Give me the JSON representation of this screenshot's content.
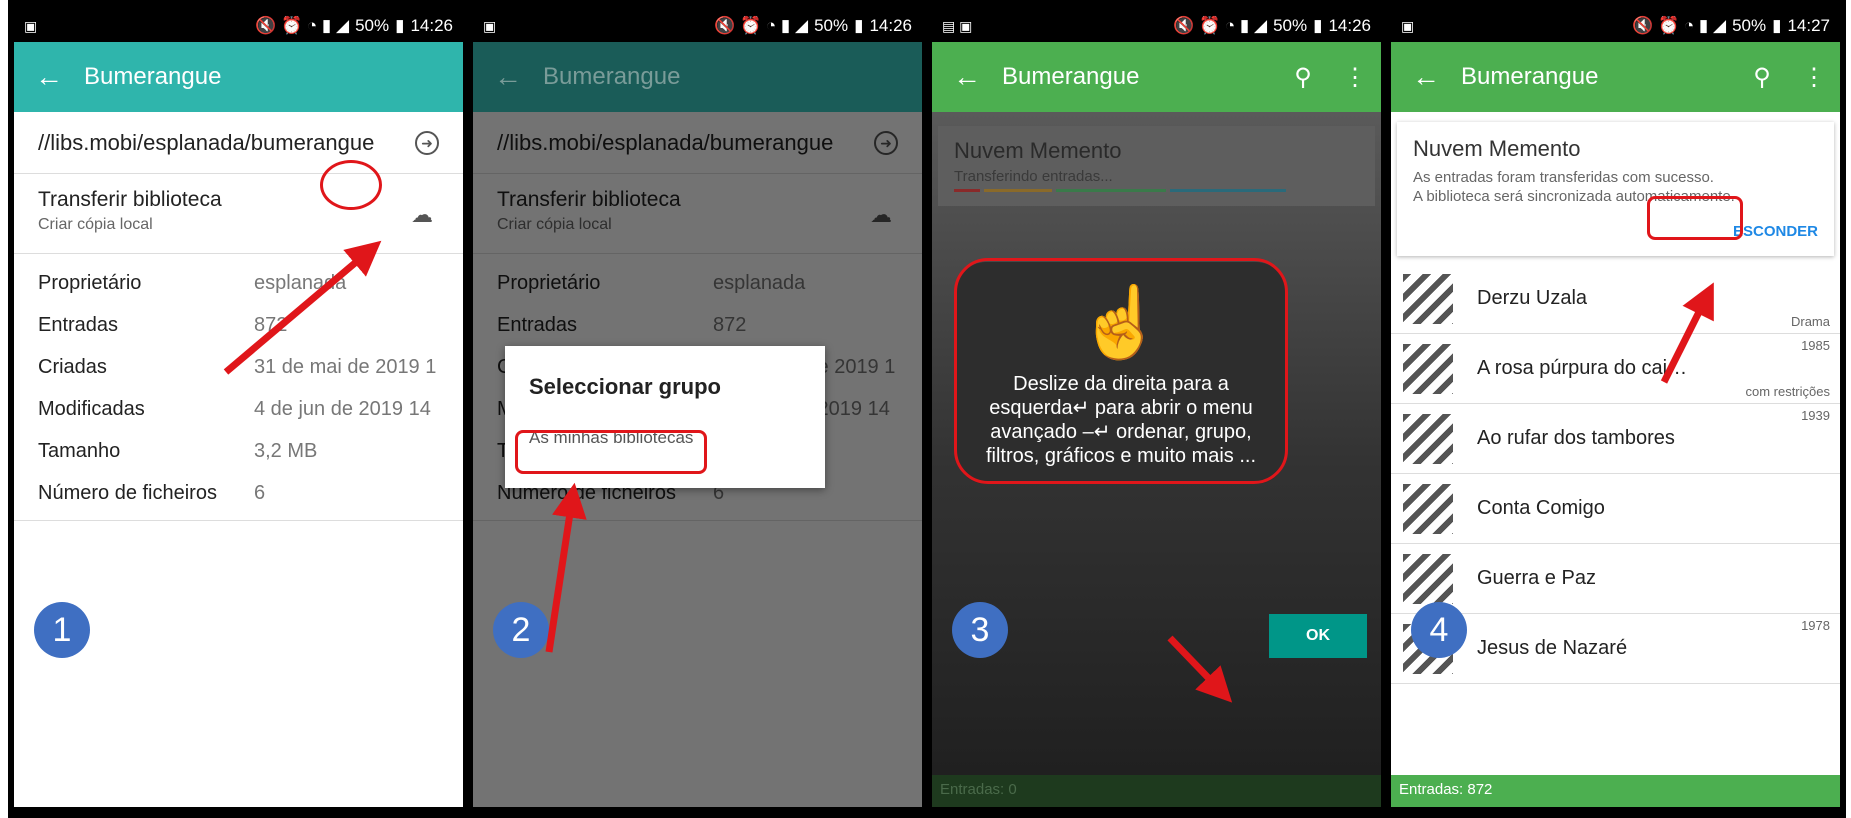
{
  "status": {
    "time1": "14:26",
    "time2": "14:26",
    "time3": "14:26",
    "time4": "14:27",
    "battery": "50%"
  },
  "app": {
    "title": "Bumerangue"
  },
  "panel1": {
    "url": "//libs.mobi/esplanada/bumerangue",
    "transfer_title": "Transferir biblioteca",
    "transfer_subtitle": "Criar cópia local",
    "props": [
      {
        "k": "Proprietário",
        "v": "esplanada"
      },
      {
        "k": "Entradas",
        "v": "872"
      },
      {
        "k": "Criadas",
        "v": "31 de mai de 2019 1"
      },
      {
        "k": "Modificadas",
        "v": "4 de jun de 2019 14"
      },
      {
        "k": "Tamanho",
        "v": "3,2 MB"
      },
      {
        "k": "Número de ficheiros",
        "v": "6"
      }
    ],
    "step": "1"
  },
  "panel2": {
    "dialog_title": "Seleccionar grupo",
    "dialog_item": "As minhas bibliotecas",
    "step": "2"
  },
  "panel3": {
    "card_title": "Nuvem Memento",
    "card_subtitle": "Transferindo entradas...",
    "tip_text": "Deslize da direita para a esquerda↵ para abrir o menu avançado –↵ ordenar, grupo, filtros, gráficos e muito mais ...",
    "ok_label": "OK",
    "footer": "Entradas: 0",
    "step": "3"
  },
  "panel4": {
    "card_title": "Nuvem Memento",
    "card_line1": "As entradas foram transferidas com sucesso.",
    "card_line2": "A biblioteca será sincronizada automaticamente.",
    "hide_label": "ESCONDER",
    "entries": [
      {
        "name": "Derzu Uzala",
        "top": "",
        "bottom": "Drama"
      },
      {
        "name": "A rosa púrpura do cai…",
        "top": "1985",
        "bottom": "com restrições"
      },
      {
        "name": "Ao rufar dos tambores",
        "top": "1939",
        "bottom": ""
      },
      {
        "name": "Conta Comigo",
        "top": "",
        "bottom": ""
      },
      {
        "name": "Guerra e Paz",
        "top": "",
        "bottom": ""
      },
      {
        "name": "Jesus de Nazaré",
        "top": "1978",
        "bottom": ""
      }
    ],
    "footer": "Entradas: 872",
    "step": "4"
  },
  "colors": {
    "teal": "#2fb5ac",
    "green": "#4caf50",
    "ok": "#009688",
    "annotation_red": "#e0161a",
    "badge_blue": "#3f6fc2"
  },
  "icons": [
    "back-arrow-icon",
    "go-arrow-icon",
    "cloud-download-icon",
    "search-icon",
    "more-vert-icon",
    "swipe-hand-icon"
  ]
}
